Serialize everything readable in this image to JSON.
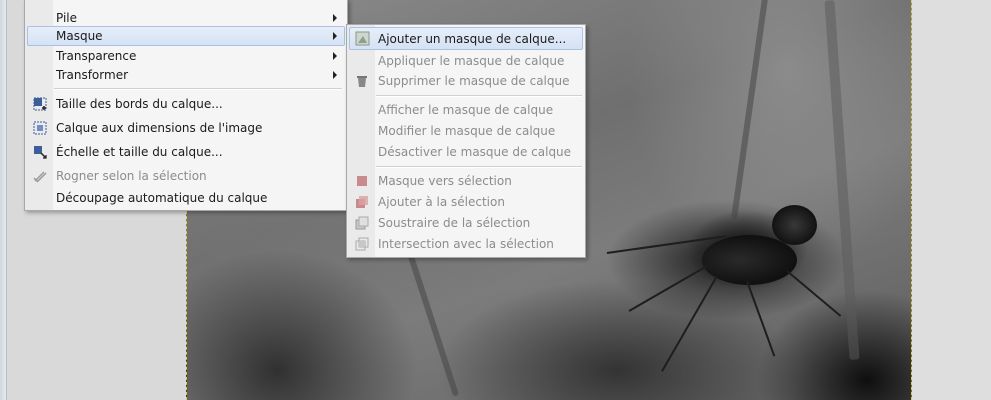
{
  "main_menu": {
    "items": [
      {
        "label": "Pile",
        "submenu": true
      },
      {
        "label": "Masque",
        "submenu": true,
        "highlighted": true
      },
      {
        "label": "Transparence",
        "submenu": true
      },
      {
        "label": "Transformer",
        "submenu": true
      },
      {
        "label": "Taille des bords du calque...",
        "icon": "layer-boundary-icon"
      },
      {
        "label": "Calque aux dimensions de l'image",
        "icon": "layer-to-image-size-icon"
      },
      {
        "label": "Échelle et taille du calque...",
        "icon": "scale-layer-icon"
      },
      {
        "label": "Rogner selon la sélection",
        "icon": "crop-icon",
        "disabled": true
      },
      {
        "label": "Découpage automatique du calque"
      }
    ]
  },
  "submenu": {
    "items": [
      {
        "label": "Ajouter un masque de calque...",
        "icon": "add-mask-icon",
        "highlighted": true
      },
      {
        "label": "Appliquer le masque de calque",
        "disabled": true
      },
      {
        "label": "Supprimer le masque de calque",
        "icon": "delete-mask-icon",
        "disabled": true
      },
      {
        "label": "Afficher le masque de calque",
        "disabled": true
      },
      {
        "label": "Modifier le masque de calque",
        "disabled": true
      },
      {
        "label": "Désactiver le masque de calque",
        "disabled": true
      },
      {
        "label": "Masque vers sélection",
        "icon": "mask-to-selection-icon",
        "disabled": true
      },
      {
        "label": "Ajouter à la sélection",
        "icon": "add-to-selection-icon",
        "disabled": true
      },
      {
        "label": "Soustraire de la sélection",
        "icon": "subtract-selection-icon",
        "disabled": true
      },
      {
        "label": "Intersection avec la sélection",
        "icon": "intersect-selection-icon",
        "disabled": true
      }
    ]
  },
  "colors": {
    "highlight_border": "#a9c2e6",
    "selection_border": "#e2d34a",
    "disabled_text": "#8c8c8c"
  }
}
